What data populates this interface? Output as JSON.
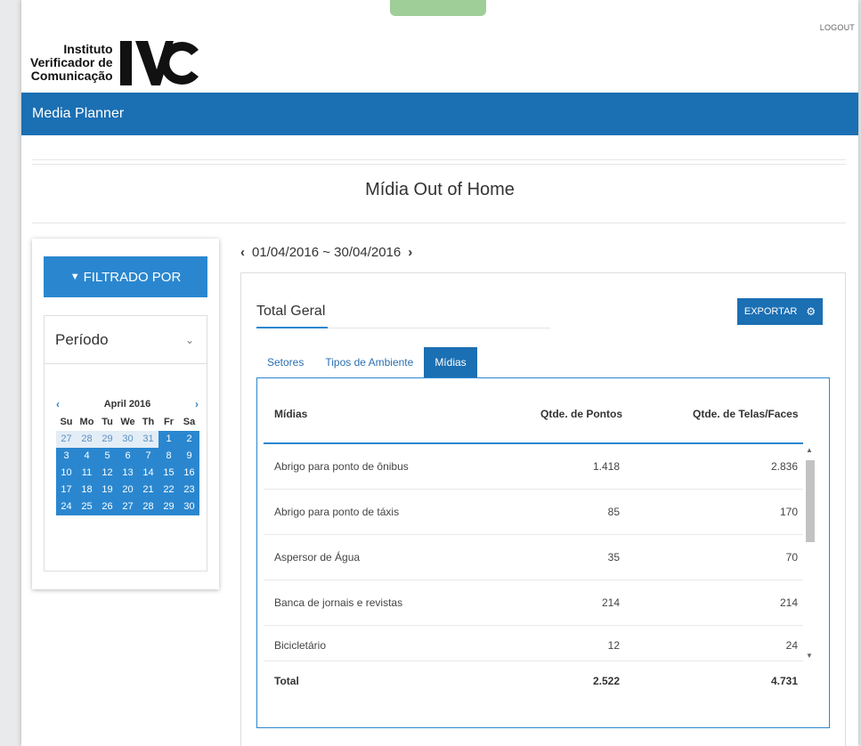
{
  "header": {
    "logout_label": "LOGOUT",
    "logo_line1": "Instituto",
    "logo_line2": "Verificador de",
    "logo_line3": "Comunicação",
    "logo_mark": "IVC",
    "app_title": "Media Planner"
  },
  "page_title": "Mídia Out of Home",
  "filter": {
    "button_label": "FILTRADO POR",
    "period_label": "Período",
    "calendar": {
      "month_label": "April 2016",
      "weekdays": [
        "Su",
        "Mo",
        "Tu",
        "We",
        "Th",
        "Fr",
        "Sa"
      ],
      "prev_month_days": [
        "27",
        "28",
        "29",
        "30",
        "31"
      ],
      "days": [
        "1",
        "2",
        "3",
        "4",
        "5",
        "6",
        "7",
        "8",
        "9",
        "10",
        "11",
        "12",
        "13",
        "14",
        "15",
        "16",
        "17",
        "18",
        "19",
        "20",
        "21",
        "22",
        "23",
        "24",
        "25",
        "26",
        "27",
        "28",
        "29",
        "30"
      ]
    }
  },
  "date_range": "01/04/2016 ~ 30/04/2016",
  "panel": {
    "title": "Total Geral",
    "export_label": "EXPORTAR",
    "tabs": [
      "Setores",
      "Tipos de Ambiente",
      "Mídias"
    ],
    "active_tab": "Mídias",
    "columns": [
      "Mídias",
      "Qtde. de Pontos",
      "Qtde. de Telas/Faces"
    ],
    "rows": [
      {
        "name": "Abrigo para ponto de ônibus",
        "pontos": "1.418",
        "telas": "2.836"
      },
      {
        "name": "Abrigo para ponto de táxis",
        "pontos": "85",
        "telas": "170"
      },
      {
        "name": "Aspersor de Água",
        "pontos": "35",
        "telas": "70"
      },
      {
        "name": "Banca de jornais e revistas",
        "pontos": "214",
        "telas": "214"
      },
      {
        "name": "Bicicletário",
        "pontos": "12",
        "telas": "24"
      }
    ],
    "total": {
      "name": "Total",
      "pontos": "2.522",
      "telas": "4.731"
    }
  },
  "colors": {
    "header_blue": "#1b6fb3",
    "accent_blue": "#2a87cf",
    "top_tab_green": "#9fce98"
  }
}
